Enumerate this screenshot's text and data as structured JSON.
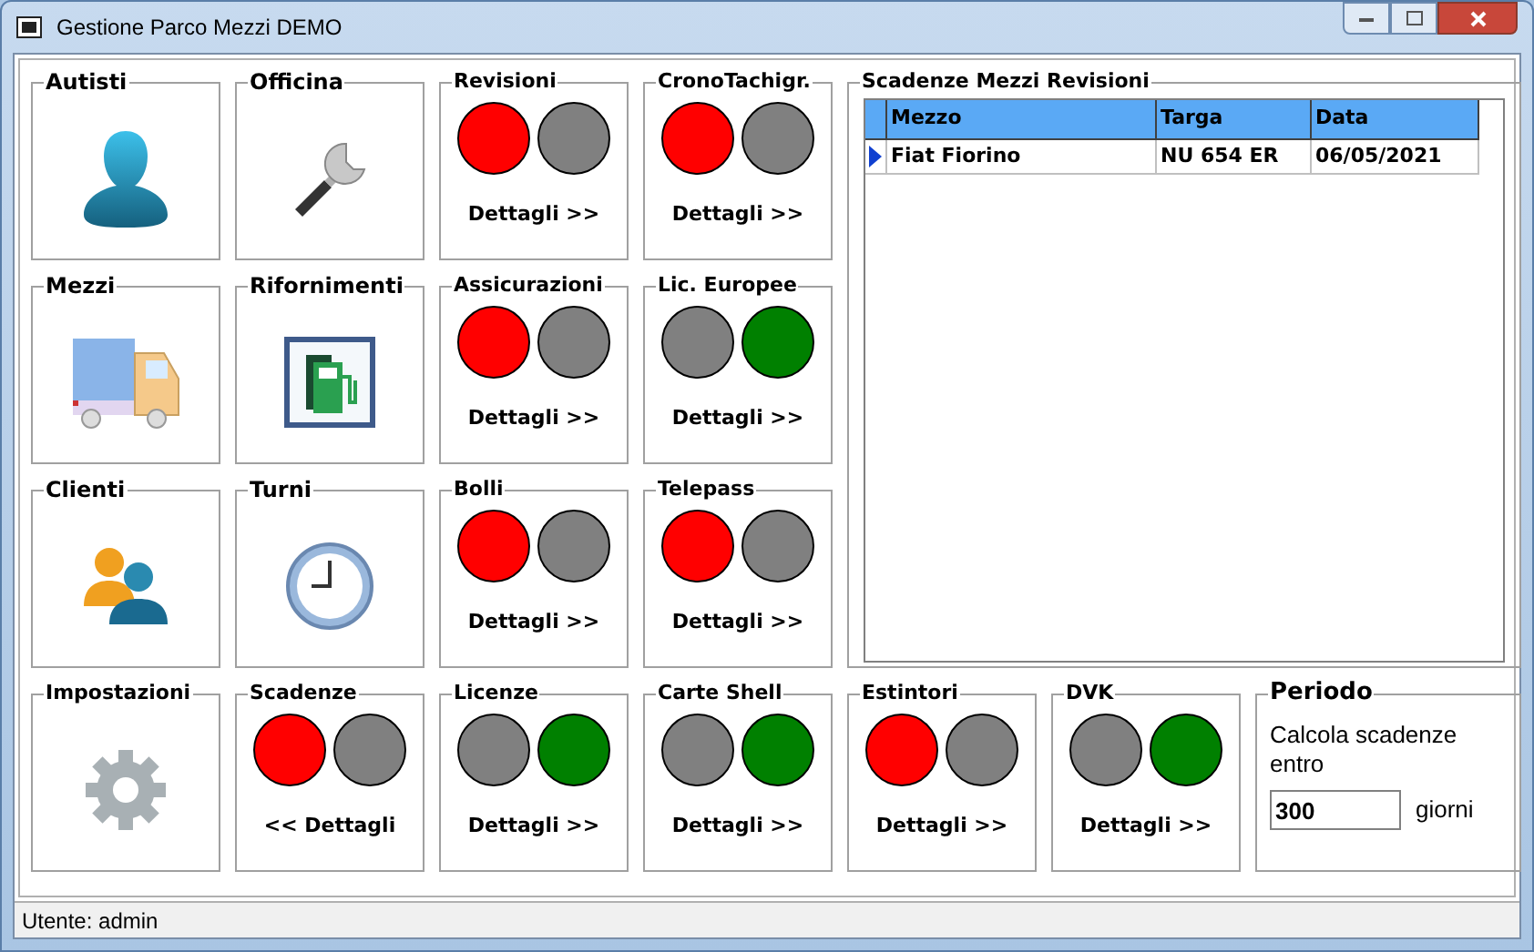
{
  "window": {
    "title": "Gestione Parco Mezzi DEMO"
  },
  "tiles": [
    {
      "kind": "icon",
      "title": "Autisti"
    },
    {
      "kind": "icon",
      "title": "Officina"
    },
    {
      "kind": "lights",
      "title": "Revisioni",
      "lights": [
        {
          "color": "#ff0000"
        },
        {
          "color": "#808080"
        }
      ],
      "link": "Dettagli >>"
    },
    {
      "kind": "lights",
      "title": "CronoTachigr.",
      "lights": [
        {
          "color": "#ff0000"
        },
        {
          "color": "#808080"
        }
      ],
      "link": "Dettagli >>"
    },
    {
      "kind": "icon",
      "title": "Mezzi"
    },
    {
      "kind": "icon",
      "title": "Rifornimenti"
    },
    {
      "kind": "lights",
      "title": "Assicurazioni",
      "lights": [
        {
          "color": "#ff0000"
        },
        {
          "color": "#808080"
        }
      ],
      "link": "Dettagli >>"
    },
    {
      "kind": "lights",
      "title": "Lic. Europee",
      "lights": [
        {
          "color": "#808080"
        },
        {
          "color": "#008000"
        }
      ],
      "link": "Dettagli >>"
    },
    {
      "kind": "icon",
      "title": "Clienti"
    },
    {
      "kind": "icon",
      "title": "Turni"
    },
    {
      "kind": "lights",
      "title": "Bolli",
      "lights": [
        {
          "color": "#ff0000"
        },
        {
          "color": "#808080"
        }
      ],
      "link": "Dettagli >>"
    },
    {
      "kind": "lights",
      "title": "Telepass",
      "lights": [
        {
          "color": "#ff0000"
        },
        {
          "color": "#808080"
        }
      ],
      "link": "Dettagli >>"
    },
    {
      "kind": "icon",
      "title": "Impostazioni"
    },
    {
      "kind": "lights",
      "title": "Scadenze",
      "lights": [
        {
          "color": "#ff0000"
        },
        {
          "color": "#808080"
        }
      ],
      "link": "<< Dettagli"
    },
    {
      "kind": "lights",
      "title": "Licenze",
      "lights": [
        {
          "color": "#808080"
        },
        {
          "color": "#008000"
        }
      ],
      "link": "Dettagli >>"
    },
    {
      "kind": "lights",
      "title": "Carte Shell",
      "lights": [
        {
          "color": "#808080"
        },
        {
          "color": "#008000"
        }
      ],
      "link": "Dettagli >>"
    },
    {
      "kind": "lights",
      "title": "Estintori",
      "lights": [
        {
          "color": "#ff0000"
        },
        {
          "color": "#808080"
        }
      ],
      "link": "Dettagli >>"
    },
    {
      "kind": "lights",
      "title": "DVK",
      "lights": [
        {
          "color": "#808080"
        },
        {
          "color": "#008000"
        }
      ],
      "link": "Dettagli >>"
    }
  ],
  "scadenze_panel": {
    "title": "Scadenze Mezzi Revisioni",
    "columns": [
      "Mezzo",
      "Targa",
      "Data"
    ],
    "rows": [
      {
        "selected": true,
        "cells": [
          "Fiat Fiorino",
          "NU 654 ER",
          "06/05/2021"
        ]
      }
    ]
  },
  "periodo": {
    "title": "Periodo",
    "label": "Calcola scadenze entro",
    "value": "300",
    "unit": "giorni"
  },
  "status_bar": "Utente: admin"
}
